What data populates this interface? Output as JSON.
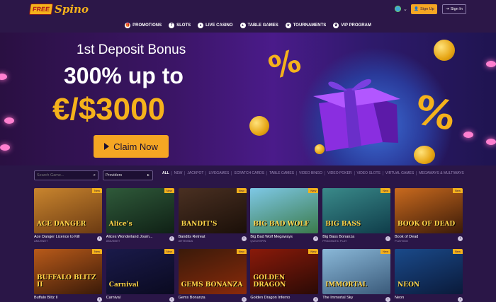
{
  "header": {
    "logo_badge": "FREE",
    "logo_text": "Spino",
    "signup_label": "Sign Up",
    "signin_label": "Sign In"
  },
  "nav": [
    {
      "label": "PROMOTIONS",
      "icon": "gift-icon"
    },
    {
      "label": "SLOTS",
      "icon": "slots-icon"
    },
    {
      "label": "LIVE CASINO",
      "icon": "live-casino-icon"
    },
    {
      "label": "TABLE GAMES",
      "icon": "table-games-icon"
    },
    {
      "label": "TOURNAMENTS",
      "icon": "trophy-icon"
    },
    {
      "label": "VIP PROGRAM",
      "icon": "crown-icon"
    }
  ],
  "hero": {
    "subtitle": "1st Deposit Bonus",
    "line1": "300% up to",
    "line2": "€/$3000",
    "cta_label": "Claim Now"
  },
  "filters": {
    "search_placeholder": "Search Game...",
    "providers_label": "Providers",
    "categories": [
      "ALL",
      "NEW",
      "JACKPOT",
      "LIVEGAMES",
      "SCRATCH CARDS",
      "TABLE GAMES",
      "VIDEO BINGO",
      "VIDEO POKER",
      "VIDEO SLOTS",
      "VIRTUAL GAMES",
      "MEGAWAYS & MULTIWAYS"
    ]
  },
  "games": [
    {
      "name": "Ace Danger Licence to Kill",
      "provider": "AMUSNET",
      "badge": "New",
      "thumb_title": "ACE DANGER",
      "color1": "#c9852e",
      "color2": "#6b3a12"
    },
    {
      "name": "Alices Wonderland Journ...",
      "provider": "AMUSNET",
      "badge": "New",
      "thumb_title": "Alice's",
      "color1": "#2f5a3a",
      "color2": "#0f2015"
    },
    {
      "name": "Bandits Retreat",
      "provider": "ARTEMIDA",
      "badge": "New",
      "thumb_title": "BANDIT'S",
      "color1": "#4a3022",
      "color2": "#1a0f08"
    },
    {
      "name": "Big Bad Wolf Megaways",
      "provider": "QUICKSPIN",
      "badge": "New",
      "thumb_title": "BIG BAD WOLF",
      "color1": "#7ec8e6",
      "color2": "#3a7a4a"
    },
    {
      "name": "Big Bass Bonanza",
      "provider": "PRAGMATIC PLAY",
      "badge": "New",
      "thumb_title": "BIG BASS",
      "color1": "#3a8a8a",
      "color2": "#0f3d4a"
    },
    {
      "name": "Book of Dead",
      "provider": "PLAYNGO",
      "badge": "New",
      "thumb_title": "BOOK OF DEAD",
      "color1": "#c96a1e",
      "color2": "#3a1a08"
    },
    {
      "name": "Buffalo Blitz II",
      "provider": "",
      "badge": "New",
      "thumb_title": "BUFFALO BLITZ II",
      "color1": "#b85a1a",
      "color2": "#3a1a08"
    },
    {
      "name": "Carnival",
      "provider": "",
      "badge": "New",
      "thumb_title": "Carnival",
      "color1": "#1a1a4a",
      "color2": "#0a0a20"
    },
    {
      "name": "Gems Bonanza",
      "provider": "",
      "badge": "New",
      "thumb_title": "GEMS BONANZA",
      "color1": "#3a1a0a",
      "color2": "#8a2a0a"
    },
    {
      "name": "Golden Dragon Inferno",
      "provider": "",
      "badge": "New",
      "thumb_title": "GOLDEN DRAGON",
      "color1": "#8a1a0a",
      "color2": "#2a0a05"
    },
    {
      "name": "The Immortal Sky",
      "provider": "",
      "badge": "New",
      "thumb_title": "IMMORTAL",
      "color1": "#8ab8d8",
      "color2": "#3a5a7a"
    },
    {
      "name": "Neon",
      "provider": "",
      "badge": "New",
      "thumb_title": "NEON",
      "color1": "#1a4a8a",
      "color2": "#0a1a3a"
    }
  ]
}
